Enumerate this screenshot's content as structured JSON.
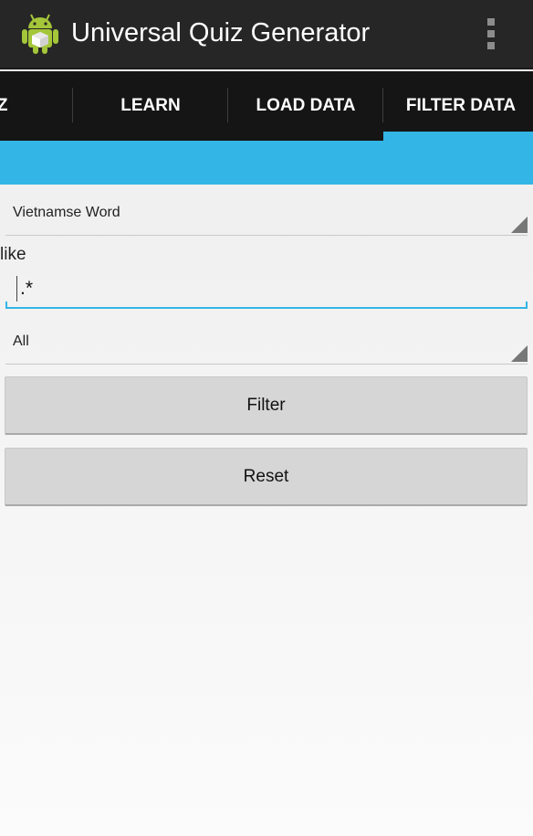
{
  "app": {
    "title": "Universal Quiz Generator",
    "icon": "android-robot-icon"
  },
  "tabs": [
    {
      "label": "IZ"
    },
    {
      "label": "LEARN"
    },
    {
      "label": "LOAD DATA"
    },
    {
      "label": "FILTER DATA",
      "selected": true
    }
  ],
  "filter": {
    "field_spinner": "Vietnamse Word",
    "operator_label": "like",
    "pattern_value": ".*",
    "scope_spinner": "All",
    "filter_button": "Filter",
    "reset_button": "Reset"
  },
  "colors": {
    "accent": "#33b5e5",
    "actionbar": "#262626",
    "tabbar": "#151515"
  }
}
